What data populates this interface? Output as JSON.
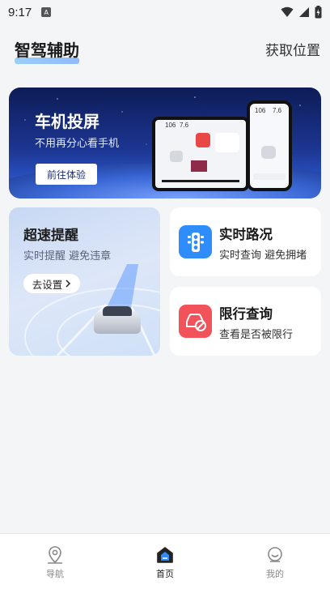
{
  "status": {
    "time": "9:17",
    "notification_glyph": "A"
  },
  "header": {
    "title": "智驾辅助",
    "location_link": "获取位置"
  },
  "banner": {
    "title": "车机投屏",
    "subtitle": "不用再分心看手机",
    "button_label": "前往体验",
    "screen_values": [
      "106",
      "7.6"
    ],
    "phone_values": [
      "106",
      "7.6"
    ]
  },
  "speed_alert": {
    "title": "超速提醒",
    "subtitle": "实时提醒 避免违章",
    "button_label": "去设置"
  },
  "features": [
    {
      "title": "实时路况",
      "subtitle": "实时查询 避免拥堵",
      "icon": "traffic-light-icon",
      "color": "#2f8dfb"
    },
    {
      "title": "限行查询",
      "subtitle": "查看是否被限行",
      "icon": "no-car-icon",
      "color": "#f2535a"
    }
  ],
  "nav": {
    "items": [
      {
        "label": "导航",
        "icon": "location-pin-icon"
      },
      {
        "label": "首页",
        "icon": "home-icon"
      },
      {
        "label": "我的",
        "icon": "profile-icon"
      }
    ],
    "active": "首页"
  }
}
